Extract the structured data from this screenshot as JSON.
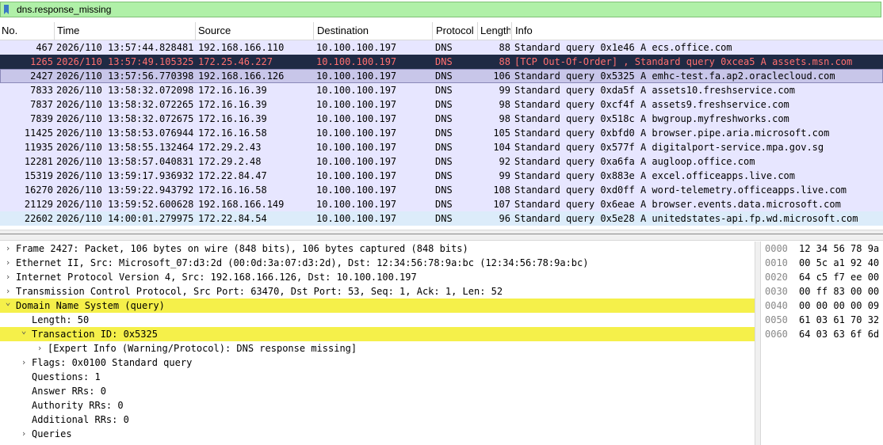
{
  "filter": {
    "text": "dns.response_missing"
  },
  "columns": [
    "No.",
    "Time",
    "Source",
    "Destination",
    "Protocol",
    "Length",
    "Info"
  ],
  "colors": {
    "normal_bg": "#e7e6ff",
    "alt_bg": "#dad8ff",
    "selected_bg": "#1f2a44",
    "selected_fg": "#ff6f6f",
    "current_bg": "#c8c6e9",
    "last_bg": "#dcecfa",
    "highlight": "#f5f04a"
  },
  "packets": [
    {
      "no": "467",
      "time": "2026/110 13:57:44.828481",
      "src": "192.168.166.110",
      "dst": "10.100.100.197",
      "proto": "DNS",
      "len": "88",
      "info": "Standard query 0x1e46 A ecs.office.com",
      "state": "normal"
    },
    {
      "no": "1265",
      "time": "2026/110 13:57:49.105325",
      "src": "172.25.46.227",
      "dst": "10.100.100.197",
      "proto": "DNS",
      "len": "88",
      "info": "[TCP Out-Of-Order] , Standard query 0xcea5 A assets.msn.com",
      "state": "dark"
    },
    {
      "no": "2427",
      "time": "2026/110 13:57:56.770398",
      "src": "192.168.166.126",
      "dst": "10.100.100.197",
      "proto": "DNS",
      "len": "106",
      "info": "Standard query 0x5325 A emhc-test.fa.ap2.oraclecloud.com",
      "state": "current"
    },
    {
      "no": "7833",
      "time": "2026/110 13:58:32.072098",
      "src": "172.16.16.39",
      "dst": "10.100.100.197",
      "proto": "DNS",
      "len": "99",
      "info": "Standard query 0xda5f A assets10.freshservice.com",
      "state": "normal"
    },
    {
      "no": "7837",
      "time": "2026/110 13:58:32.072265",
      "src": "172.16.16.39",
      "dst": "10.100.100.197",
      "proto": "DNS",
      "len": "98",
      "info": "Standard query 0xcf4f A assets9.freshservice.com",
      "state": "normal"
    },
    {
      "no": "7839",
      "time": "2026/110 13:58:32.072675",
      "src": "172.16.16.39",
      "dst": "10.100.100.197",
      "proto": "DNS",
      "len": "98",
      "info": "Standard query 0x518c A bwgroup.myfreshworks.com",
      "state": "normal"
    },
    {
      "no": "11425",
      "time": "2026/110 13:58:53.076944",
      "src": "172.16.16.58",
      "dst": "10.100.100.197",
      "proto": "DNS",
      "len": "105",
      "info": "Standard query 0xbfd0 A browser.pipe.aria.microsoft.com",
      "state": "normal"
    },
    {
      "no": "11935",
      "time": "2026/110 13:58:55.132464",
      "src": "172.29.2.43",
      "dst": "10.100.100.197",
      "proto": "DNS",
      "len": "104",
      "info": "Standard query 0x577f A digitalport-service.mpa.gov.sg",
      "state": "normal"
    },
    {
      "no": "12281",
      "time": "2026/110 13:58:57.040831",
      "src": "172.29.2.48",
      "dst": "10.100.100.197",
      "proto": "DNS",
      "len": "92",
      "info": "Standard query 0xa6fa A augloop.office.com",
      "state": "normal"
    },
    {
      "no": "15319",
      "time": "2026/110 13:59:17.936932",
      "src": "172.22.84.47",
      "dst": "10.100.100.197",
      "proto": "DNS",
      "len": "99",
      "info": "Standard query 0x883e A excel.officeapps.live.com",
      "state": "normal"
    },
    {
      "no": "16270",
      "time": "2026/110 13:59:22.943792",
      "src": "172.16.16.58",
      "dst": "10.100.100.197",
      "proto": "DNS",
      "len": "108",
      "info": "Standard query 0xd0ff A word-telemetry.officeapps.live.com",
      "state": "normal"
    },
    {
      "no": "21129",
      "time": "2026/110 13:59:52.600628",
      "src": "192.168.166.149",
      "dst": "10.100.100.197",
      "proto": "DNS",
      "len": "107",
      "info": "Standard query 0x6eae A browser.events.data.microsoft.com",
      "state": "normal"
    },
    {
      "no": "22602",
      "time": "2026/110 14:00:01.279975",
      "src": "172.22.84.54",
      "dst": "10.100.100.197",
      "proto": "DNS",
      "len": "96",
      "info": "Standard query 0x5e28 A unitedstates-api.fp.wd.microsoft.com",
      "state": "last"
    }
  ],
  "details": [
    {
      "text": "Frame 2427: Packet, 106 bytes on wire (848 bits), 106 bytes captured (848 bits)",
      "indent": 0,
      "arrow": "right",
      "sel": false
    },
    {
      "text": "Ethernet II, Src: Microsoft_07:d3:2d (00:0d:3a:07:d3:2d), Dst: 12:34:56:78:9a:bc (12:34:56:78:9a:bc)",
      "indent": 0,
      "arrow": "right",
      "sel": false
    },
    {
      "text": "Internet Protocol Version 4, Src: 192.168.166.126, Dst: 10.100.100.197",
      "indent": 0,
      "arrow": "right",
      "sel": false
    },
    {
      "text": "Transmission Control Protocol, Src Port: 63470, Dst Port: 53, Seq: 1, Ack: 1, Len: 52",
      "indent": 0,
      "arrow": "right",
      "sel": false
    },
    {
      "text": "Domain Name System (query)",
      "indent": 0,
      "arrow": "down",
      "sel": true
    },
    {
      "text": "Length: 50",
      "indent": 1,
      "arrow": "none",
      "sel": false
    },
    {
      "text": "Transaction ID: 0x5325",
      "indent": 1,
      "arrow": "down",
      "sel": true
    },
    {
      "text": "[Expert Info (Warning/Protocol): DNS response missing]",
      "indent": 2,
      "arrow": "right",
      "sel": false
    },
    {
      "text": "Flags: 0x0100 Standard query",
      "indent": 1,
      "arrow": "right",
      "sel": false
    },
    {
      "text": "Questions: 1",
      "indent": 1,
      "arrow": "none",
      "sel": false
    },
    {
      "text": "Answer RRs: 0",
      "indent": 1,
      "arrow": "none",
      "sel": false
    },
    {
      "text": "Authority RRs: 0",
      "indent": 1,
      "arrow": "none",
      "sel": false
    },
    {
      "text": "Additional RRs: 0",
      "indent": 1,
      "arrow": "none",
      "sel": false
    },
    {
      "text": "Queries",
      "indent": 1,
      "arrow": "right",
      "sel": false
    }
  ],
  "bytes": [
    {
      "off": "0000",
      "hex": "12 34 56 78 9a"
    },
    {
      "off": "0010",
      "hex": "00 5c a1 92 40"
    },
    {
      "off": "0020",
      "hex": "64 c5 f7 ee 00"
    },
    {
      "off": "0030",
      "hex": "00 ff 83 00 00"
    },
    {
      "off": "0040",
      "hex": "00 00 00 00 09"
    },
    {
      "off": "0050",
      "hex": "61 03 61 70 32"
    },
    {
      "off": "0060",
      "hex": "64 03 63 6f 6d"
    }
  ]
}
